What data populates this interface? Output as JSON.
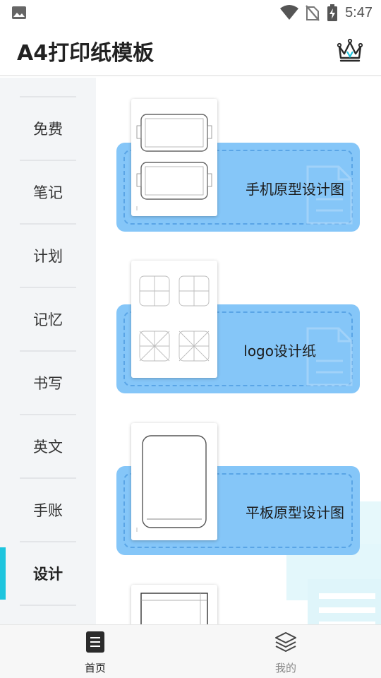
{
  "status_bar": {
    "time": "5:47"
  },
  "header": {
    "title": "A4打印纸模板"
  },
  "sidebar": {
    "items": [
      {
        "label": "免费"
      },
      {
        "label": "笔记"
      },
      {
        "label": "计划"
      },
      {
        "label": "记忆"
      },
      {
        "label": "书写"
      },
      {
        "label": "英文"
      },
      {
        "label": "手账"
      },
      {
        "label": "设计"
      }
    ],
    "active": "设计"
  },
  "templates": [
    {
      "label": "手机原型设计图"
    },
    {
      "label": "logo设计纸"
    },
    {
      "label": "平板原型设计图"
    }
  ],
  "bottom_nav": {
    "home_label": "首页",
    "mine_label": "我的"
  },
  "colors": {
    "card": "#85c6f8",
    "accent": "#1ec5de",
    "sidebar_bg": "#f3f5f7"
  }
}
